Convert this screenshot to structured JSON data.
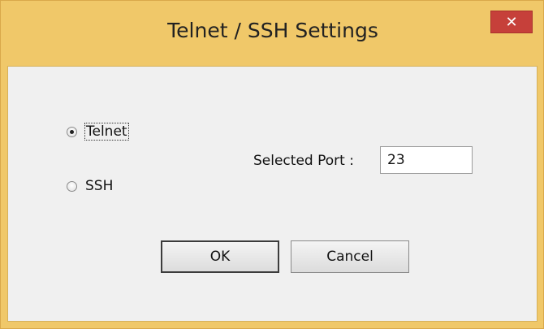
{
  "window": {
    "title": "Telnet / SSH Settings",
    "close_glyph": "✕"
  },
  "protocol": {
    "options": [
      {
        "label": "Telnet",
        "checked": true
      },
      {
        "label": "SSH",
        "checked": false
      }
    ]
  },
  "port": {
    "label": "Selected Port :",
    "value": "23"
  },
  "buttons": {
    "ok": "OK",
    "cancel": "Cancel"
  },
  "colors": {
    "frame": "#f0c869",
    "close_button": "#c6403a",
    "client": "#f0f0f0"
  }
}
